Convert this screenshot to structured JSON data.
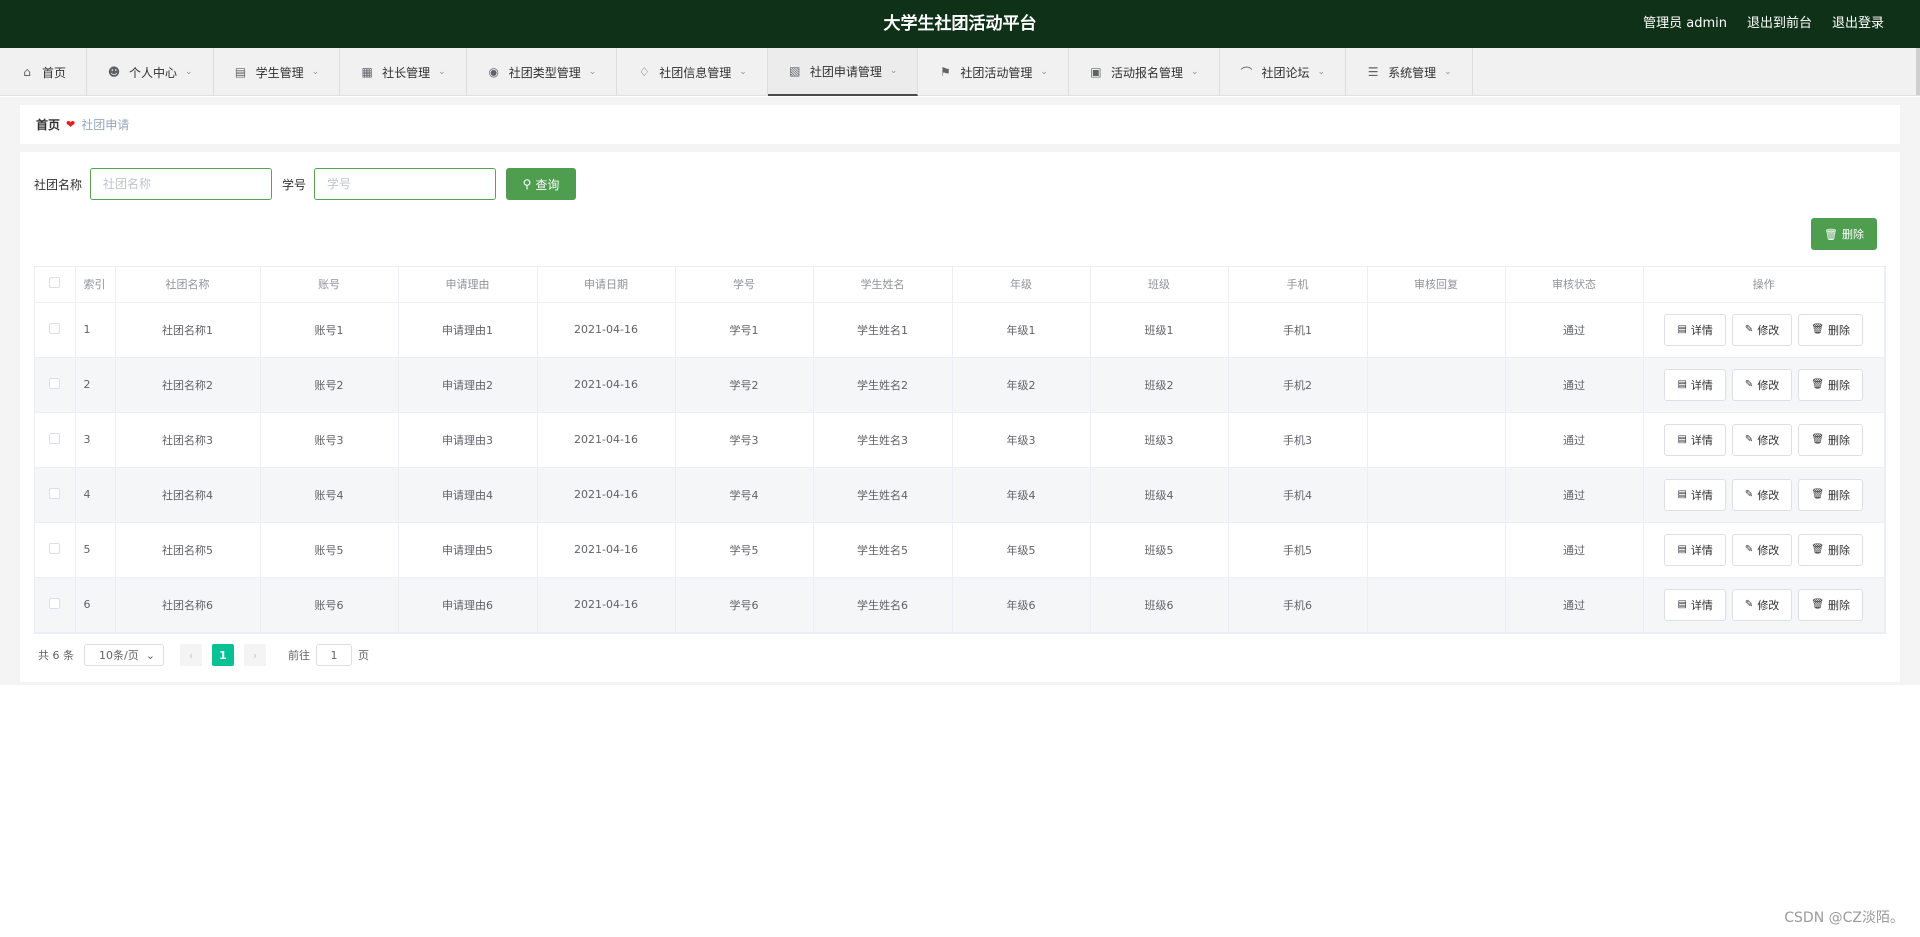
{
  "header": {
    "title": "大学生社团活动平台",
    "admin": "管理员 admin",
    "to_front": "退出到前台",
    "logout": "退出登录"
  },
  "menu": [
    {
      "label": "首页",
      "icon": "home-icon",
      "has_chevron": false
    },
    {
      "label": "个人中心",
      "icon": "user-icon",
      "has_chevron": true
    },
    {
      "label": "学生管理",
      "icon": "box-icon",
      "has_chevron": true
    },
    {
      "label": "社长管理",
      "icon": "chart-icon",
      "has_chevron": true
    },
    {
      "label": "社团类型管理",
      "icon": "location-icon",
      "has_chevron": true
    },
    {
      "label": "社团信息管理",
      "icon": "bell-icon",
      "has_chevron": true
    },
    {
      "label": "社团申请管理",
      "icon": "notebook-icon",
      "has_chevron": true,
      "active": true
    },
    {
      "label": "社团活动管理",
      "icon": "flag-icon",
      "has_chevron": true
    },
    {
      "label": "活动报名管理",
      "icon": "ticket-icon",
      "has_chevron": true
    },
    {
      "label": "社团论坛",
      "icon": "crop-icon",
      "has_chevron": true
    },
    {
      "label": "系统管理",
      "icon": "list-icon",
      "has_chevron": true
    }
  ],
  "breadcrumb": {
    "home": "首页",
    "current": "社团申请"
  },
  "search": {
    "name_label": "社团名称",
    "name_placeholder": "社团名称",
    "id_label": "学号",
    "id_placeholder": "学号",
    "query_label": "查询"
  },
  "top_delete_label": "删除",
  "table": {
    "headers": [
      "索引",
      "社团名称",
      "账号",
      "申请理由",
      "申请日期",
      "学号",
      "学生姓名",
      "年级",
      "班级",
      "手机",
      "审核回复",
      "审核状态",
      "操作"
    ],
    "rows": [
      [
        "1",
        "社团名称1",
        "账号1",
        "申请理由1",
        "2021-04-16",
        "学号1",
        "学生姓名1",
        "年级1",
        "班级1",
        "手机1",
        "",
        "通过"
      ],
      [
        "2",
        "社团名称2",
        "账号2",
        "申请理由2",
        "2021-04-16",
        "学号2",
        "学生姓名2",
        "年级2",
        "班级2",
        "手机2",
        "",
        "通过"
      ],
      [
        "3",
        "社团名称3",
        "账号3",
        "申请理由3",
        "2021-04-16",
        "学号3",
        "学生姓名3",
        "年级3",
        "班级3",
        "手机3",
        "",
        "通过"
      ],
      [
        "4",
        "社团名称4",
        "账号4",
        "申请理由4",
        "2021-04-16",
        "学号4",
        "学生姓名4",
        "年级4",
        "班级4",
        "手机4",
        "",
        "通过"
      ],
      [
        "5",
        "社团名称5",
        "账号5",
        "申请理由5",
        "2021-04-16",
        "学号5",
        "学生姓名5",
        "年级5",
        "班级5",
        "手机5",
        "",
        "通过"
      ],
      [
        "6",
        "社团名称6",
        "账号6",
        "申请理由6",
        "2021-04-16",
        "学号6",
        "学生姓名6",
        "年级6",
        "班级6",
        "手机6",
        "",
        "通过"
      ]
    ],
    "actions": {
      "detail": "详情",
      "edit": "修改",
      "delete": "删除"
    }
  },
  "pagination": {
    "total": "共 6 条",
    "page_size": "10条/页",
    "current_page": "1",
    "goto_label": "前往",
    "goto_value": "1",
    "page_suffix": "页"
  },
  "watermark": "CSDN @CZ淡陌。",
  "colors": {
    "header_bg": "#0f3118",
    "accent_green": "#4f9d4f",
    "page_active": "#06c193"
  }
}
